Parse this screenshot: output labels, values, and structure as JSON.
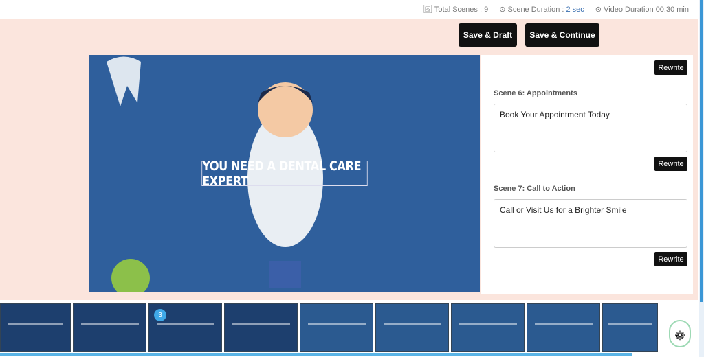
{
  "stats": {
    "total_scenes": "Total Scenes : 9",
    "scene_duration_label": "Scene Duration :",
    "scene_duration_value": "2 sec",
    "video_duration": "Video Duration 00:30 min"
  },
  "toolbar": {
    "save_draft": "Save & Draft",
    "save_continue": "Save & Continue"
  },
  "preview": {
    "caption": "YOU NEED A DENTAL CARE EXPERT"
  },
  "scenes": [
    {
      "label": "Scene 6: Appointments",
      "text": "Book Your Appointment Today",
      "rewrite": "Rewrite"
    },
    {
      "label": "Scene 7: Call to Action",
      "text": "Call or Visit Us for a Brighter Smile",
      "rewrite": "Rewrite"
    }
  ],
  "top_rewrite": "Rewrite",
  "timeline": {
    "selected_badge": "3"
  }
}
